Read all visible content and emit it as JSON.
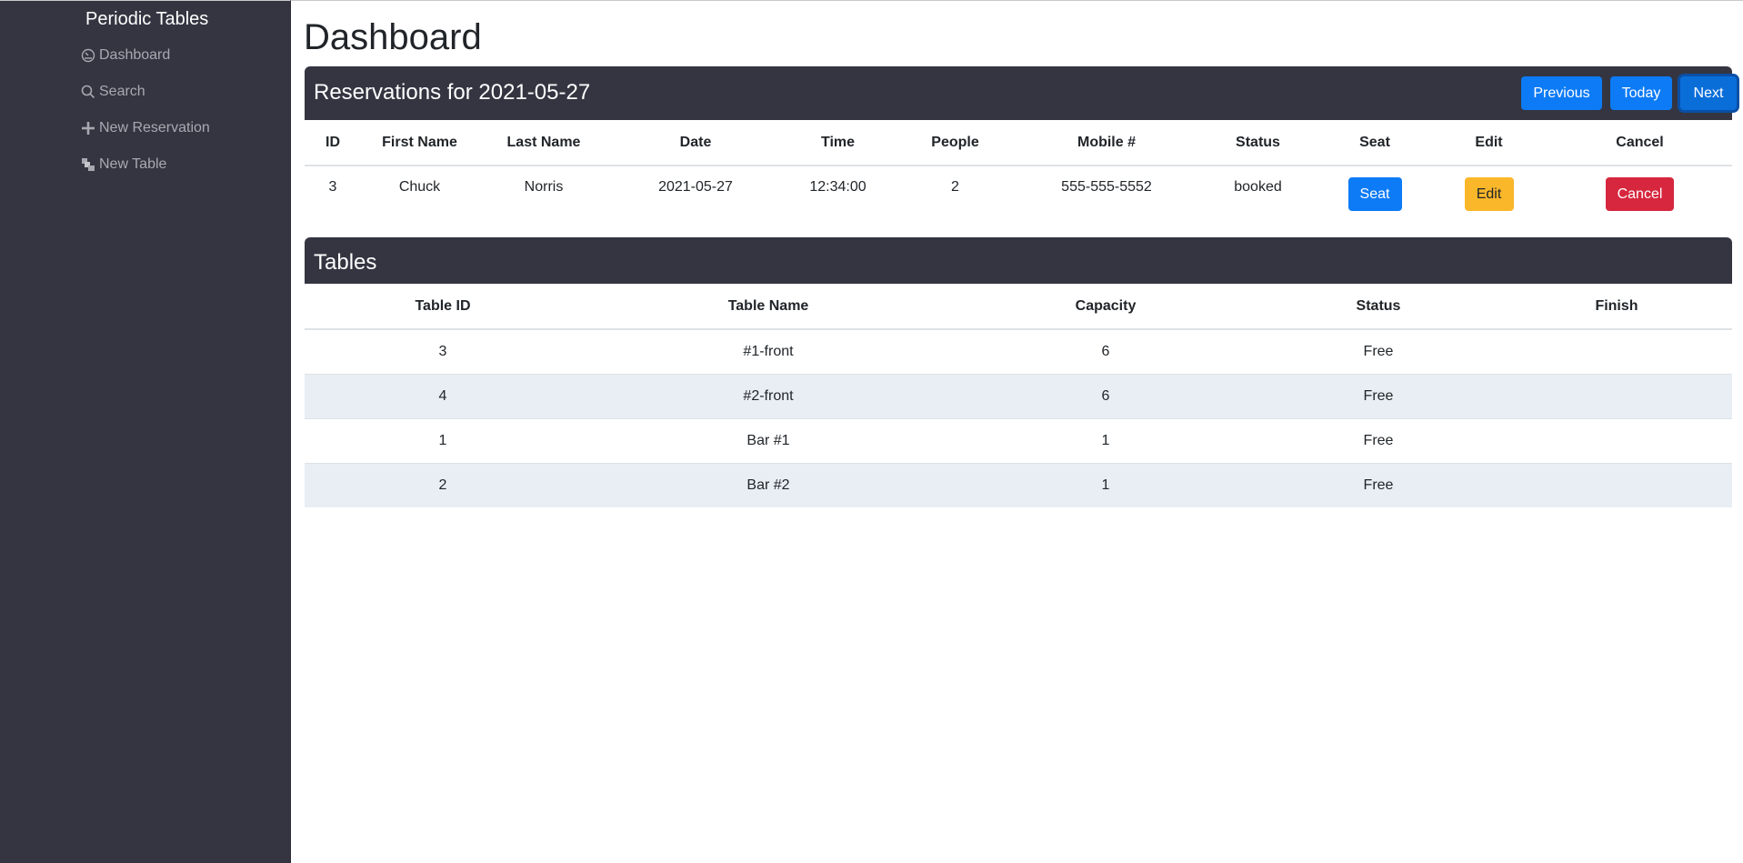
{
  "sidebar": {
    "brand": "Periodic Tables",
    "items": [
      {
        "label": "Dashboard",
        "icon": "dashboard-icon"
      },
      {
        "label": "Search",
        "icon": "search-icon"
      },
      {
        "label": "New Reservation",
        "icon": "plus-icon"
      },
      {
        "label": "New Table",
        "icon": "layers-icon"
      }
    ]
  },
  "main": {
    "title": "Dashboard",
    "reservations": {
      "heading": "Reservations for 2021-05-27",
      "buttons": {
        "previous": "Previous",
        "today": "Today",
        "next": "Next"
      },
      "columns": [
        "ID",
        "First Name",
        "Last Name",
        "Date",
        "Time",
        "People",
        "Mobile #",
        "Status",
        "Seat",
        "Edit",
        "Cancel"
      ],
      "rows": [
        {
          "id": "3",
          "first_name": "Chuck",
          "last_name": "Norris",
          "date": "2021-05-27",
          "time": "12:34:00",
          "people": "2",
          "mobile": "555-555-5552",
          "status": "booked",
          "seat_label": "Seat",
          "edit_label": "Edit",
          "cancel_label": "Cancel"
        }
      ]
    },
    "tables": {
      "heading": "Tables",
      "columns": [
        "Table ID",
        "Table Name",
        "Capacity",
        "Status",
        "Finish"
      ],
      "rows": [
        {
          "table_id": "3",
          "table_name": "#1-front",
          "capacity": "6",
          "status": "Free",
          "finish": ""
        },
        {
          "table_id": "4",
          "table_name": "#2-front",
          "capacity": "6",
          "status": "Free",
          "finish": ""
        },
        {
          "table_id": "1",
          "table_name": "Bar #1",
          "capacity": "1",
          "status": "Free",
          "finish": ""
        },
        {
          "table_id": "2",
          "table_name": "Bar #2",
          "capacity": "1",
          "status": "Free",
          "finish": ""
        }
      ]
    }
  },
  "colors": {
    "sidebar_bg": "#343541",
    "primary": "#0d7bf5",
    "warning": "#fbb72a",
    "danger": "#d6273e",
    "stripe": "#e9eef5"
  }
}
